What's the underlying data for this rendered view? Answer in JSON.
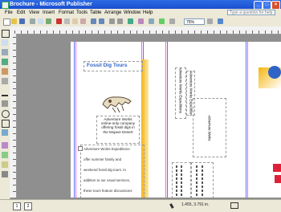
{
  "window": {
    "title": "Brochure - Microsoft Publisher"
  },
  "menu": [
    "File",
    "Edit",
    "View",
    "Insert",
    "Format",
    "Tools",
    "Table",
    "Arrange",
    "Window",
    "Help"
  ],
  "help_placeholder": "Type a question for help",
  "toolbar": {
    "zoom": "75%"
  },
  "document": {
    "heading": "Fossil Dig Tours",
    "caption": "Adventure Works online-only company offering fossil digs in the Mojave Desert",
    "body_lines": [
      "Adventure Works Expeditions",
      "offer summer family and",
      "weekend fossil dig tours. In",
      "addition to our usual services,",
      "these tours feature discussions"
    ],
    "side_text_1": "Adventure Works Expeditions",
    "side_text_2": "Adventure Works"
  },
  "status": {
    "position": "1.455, 3.791 in."
  },
  "colors": {
    "titlebar": "#1f56d8",
    "heading": "#2e64c8",
    "accent": "#f3b21a"
  }
}
